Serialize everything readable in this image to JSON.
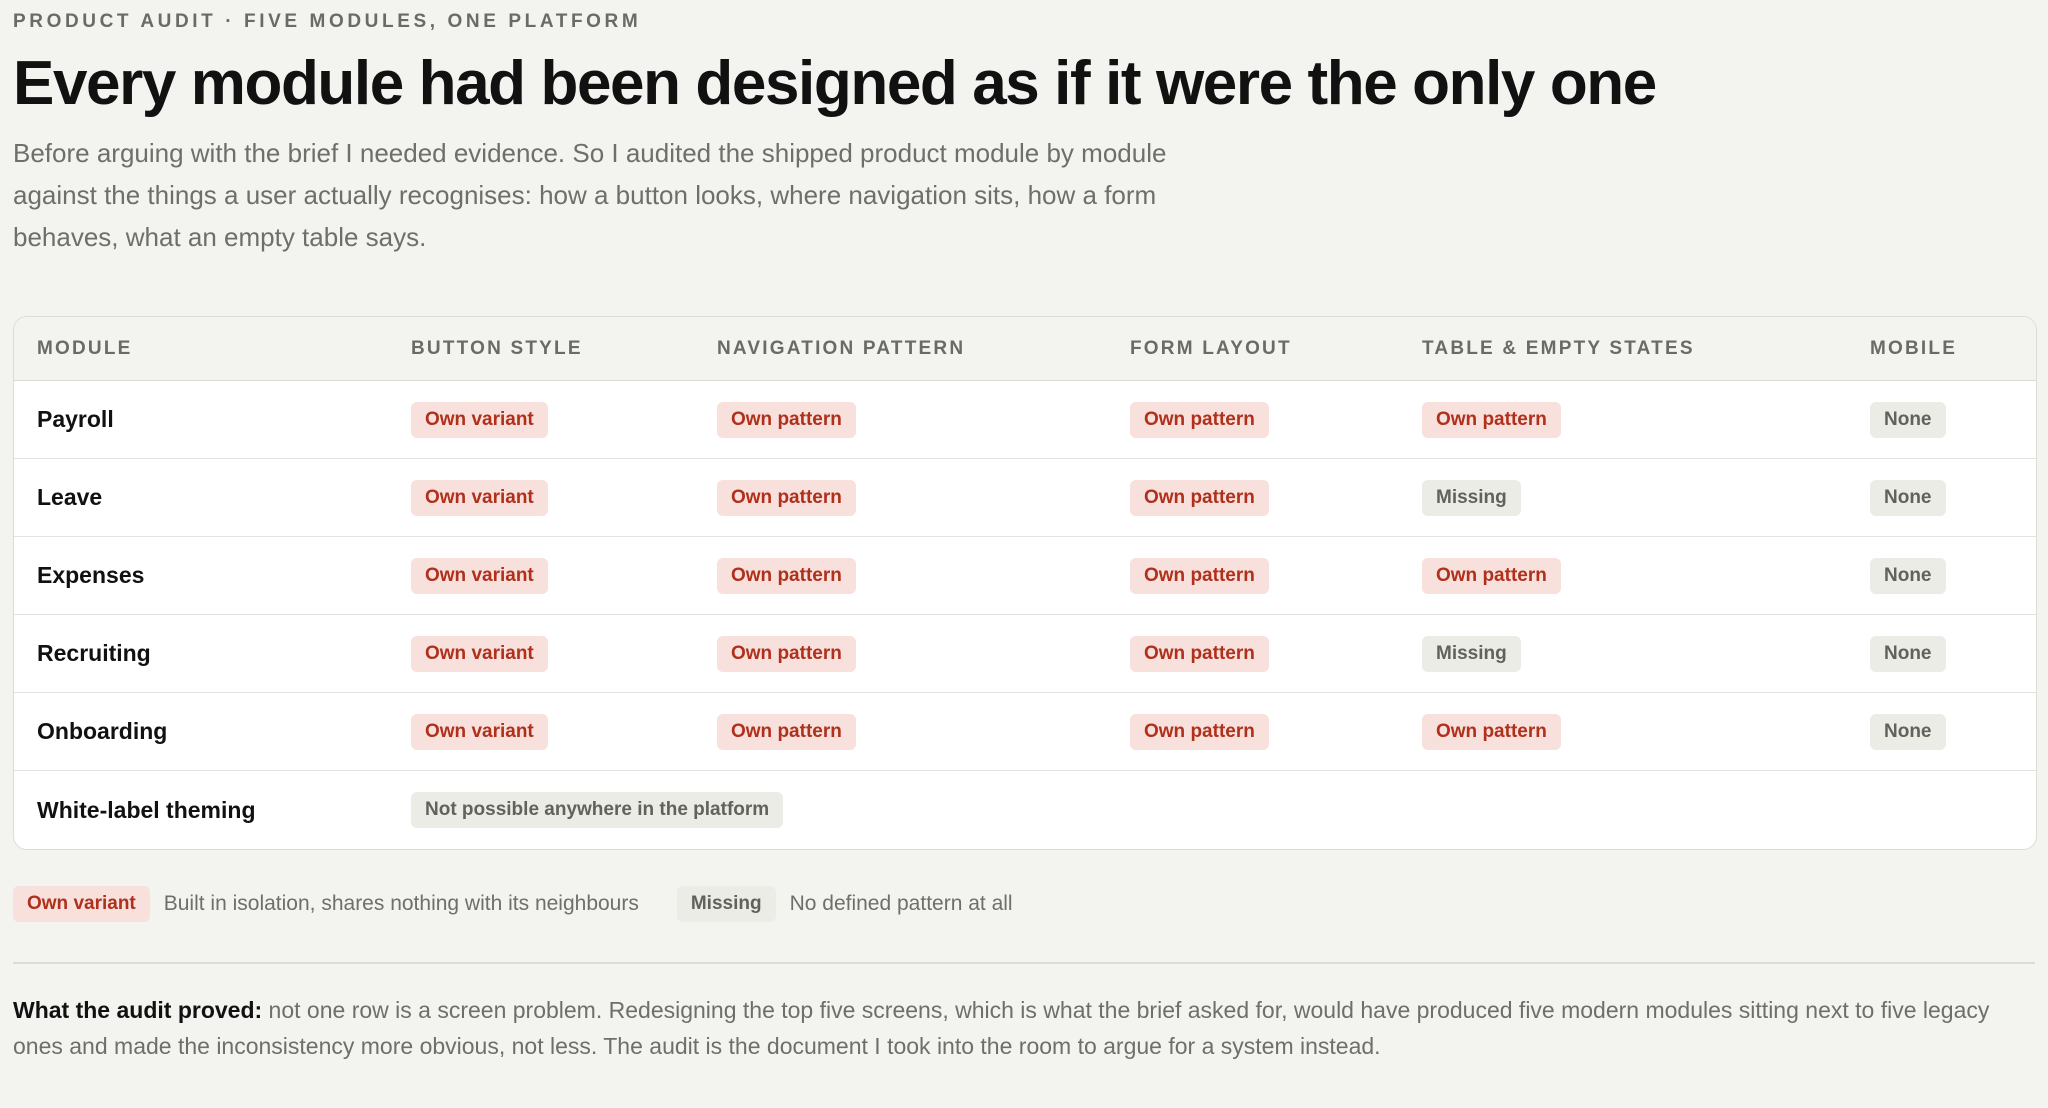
{
  "header": {
    "eyebrow": "PRODUCT AUDIT · FIVE MODULES, ONE PLATFORM",
    "title": "Every module had been designed as if it were the only one",
    "intro": "Before arguing with the brief I needed evidence. So I audited the shipped product module by module against the things a user actually recognises: how a button looks, where navigation sits, how a form behaves, what an empty table says."
  },
  "table": {
    "columns": [
      "MODULE",
      "BUTTON STYLE",
      "NAVIGATION PATTERN",
      "FORM LAYOUT",
      "TABLE & EMPTY STATES",
      "MOBILE"
    ],
    "rows": [
      {
        "module": "Payroll",
        "button": "Own variant",
        "navigation": "Own pattern",
        "form": "Own pattern",
        "table_states": "Own pattern",
        "table_states_tone": "red",
        "mobile": "None"
      },
      {
        "module": "Leave",
        "button": "Own variant",
        "navigation": "Own pattern",
        "form": "Own pattern",
        "table_states": "Missing",
        "table_states_tone": "gray",
        "mobile": "None"
      },
      {
        "module": "Expenses",
        "button": "Own variant",
        "navigation": "Own pattern",
        "form": "Own pattern",
        "table_states": "Own pattern",
        "table_states_tone": "red",
        "mobile": "None"
      },
      {
        "module": "Recruiting",
        "button": "Own variant",
        "navigation": "Own pattern",
        "form": "Own pattern",
        "table_states": "Missing",
        "table_states_tone": "gray",
        "mobile": "None"
      },
      {
        "module": "Onboarding",
        "button": "Own variant",
        "navigation": "Own pattern",
        "form": "Own pattern",
        "table_states": "Own pattern",
        "table_states_tone": "red",
        "mobile": "None"
      }
    ],
    "theming_row": {
      "module": "White-label theming",
      "value": "Not possible anywhere in the platform"
    }
  },
  "legend": {
    "own_variant_label": "Own variant",
    "own_variant_desc": "Built in isolation, shares nothing with its neighbours",
    "missing_label": "Missing",
    "missing_desc": "No defined pattern at all"
  },
  "conclusion": {
    "lead": "What the audit proved:",
    "body": " not one row is a screen problem. Redesigning the top five screens, which is what the brief asked for, would have produced five modern modules sitting next to five legacy ones and made the inconsistency more obvious, not less. The audit is the document I took into the room to argue for a system instead."
  },
  "colors": {
    "background": "#f3f3ef",
    "pill_red_bg": "#f8e0dc",
    "pill_red_text": "#b0301c",
    "pill_gray_bg": "#ecece7",
    "pill_gray_text": "#62625d"
  }
}
